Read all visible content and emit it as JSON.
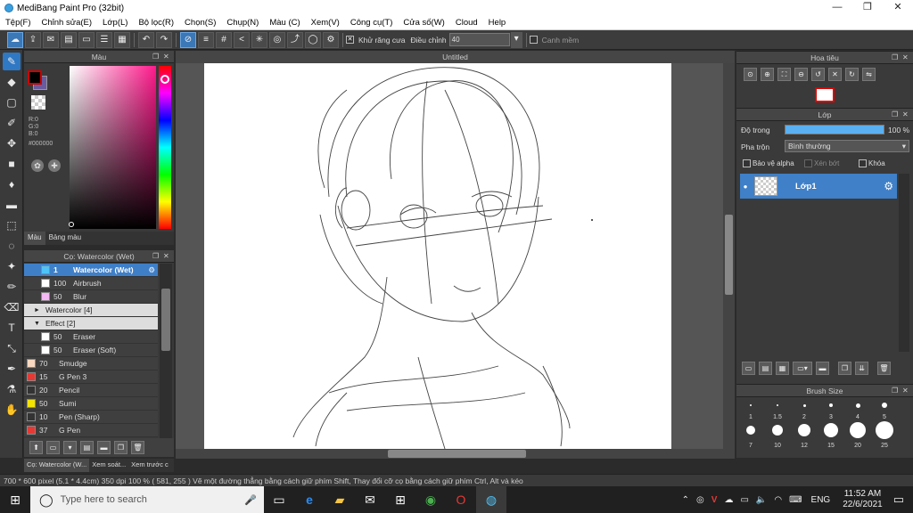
{
  "app": {
    "title": "MediBang Paint Pro (32bit)"
  },
  "menu": [
    "Tệp(F)",
    "Chỉnh sửa(E)",
    "Lớp(L)",
    "Bộ lọc(R)",
    "Chọn(S)",
    "Chụp(N)",
    "Màu (C)",
    "Xem(V)",
    "Công cụ(T)",
    "Cửa số(W)",
    "Cloud",
    "Help"
  ],
  "toolbar": {
    "antialias_label": "Khử răng cưa",
    "adjust_label": "Điều chỉnh",
    "adjust_value": "40",
    "edge_label": "Canh mềm"
  },
  "color_panel": {
    "title": "Màu",
    "rgb": [
      "R:0",
      "G:0",
      "B:0"
    ],
    "hex": "#000000",
    "tabs": [
      "Màu",
      "Bảng màu"
    ],
    "primary_color": "#000000",
    "secondary_color": "#6a5aa0",
    "hue_color": "#ff1a8c"
  },
  "brush_panel": {
    "title": "Cọ: Watercolor (Wet)",
    "rows": [
      {
        "size": "1",
        "name": "Watercolor (Wet)",
        "color": "#4fc3f7",
        "indent": 2,
        "selected": true
      },
      {
        "size": "100",
        "name": "Airbrush",
        "color": "#ffffff",
        "indent": 2
      },
      {
        "size": "50",
        "name": "Blur",
        "color": "#f4b8f4",
        "indent": 2
      },
      {
        "name": "Watercolor [4]",
        "group": true,
        "arrow": "►",
        "indent": 1
      },
      {
        "name": "Effect [2]",
        "group": true,
        "arrow": "▼",
        "indent": 1
      },
      {
        "size": "50",
        "name": "Eraser",
        "color": "#ffffff",
        "indent": 2
      },
      {
        "size": "50",
        "name": "Eraser (Soft)",
        "color": "#ffffff",
        "indent": 2
      },
      {
        "size": "70",
        "name": "Smudge",
        "color": "#f8d8c0",
        "indent": 0
      },
      {
        "size": "15",
        "name": "G Pen 3",
        "color": "#e53935",
        "indent": 0
      },
      {
        "size": "20",
        "name": "Pencil",
        "color": "#333333",
        "indent": 0
      },
      {
        "size": "50",
        "name": "Sumi",
        "color": "#f4e400",
        "indent": 0
      },
      {
        "size": "10",
        "name": "Pen (Sharp)",
        "color": "#333333",
        "indent": 0
      },
      {
        "size": "37",
        "name": "G Pen",
        "color": "#e53935",
        "indent": 0
      }
    ],
    "bottom_tabs": [
      "Cọ: Watercolor (W...",
      "Xem soát...",
      "Xem trước c"
    ]
  },
  "canvas": {
    "tab": "Untitled"
  },
  "navigator": {
    "title": "Hoa tiêu"
  },
  "layer_panel": {
    "title": "Lớp",
    "opacity_label": "Độ trong",
    "opacity_value": "100 %",
    "opacity": 1.0,
    "blend_label": "Pha trộn",
    "blend_value": "Bình thường",
    "protect_alpha": "Bảo vệ alpha",
    "clip": "Xén bớt",
    "lock": "Khóa",
    "layer_name": "Lớp1"
  },
  "brush_size": {
    "title": "Brush Size",
    "row1": [
      "1",
      "1.5",
      "2",
      "3",
      "4",
      "5"
    ],
    "row2": [
      "7",
      "10",
      "12",
      "15",
      "20",
      "25"
    ]
  },
  "status": {
    "text": "700 * 600 pixel  (5.1 * 4.4cm)  350 dpi  100 %  ( 581, 255 )  Vẽ một đường thẳng bằng cách giữ phím Shift, Thay đổi cỡ cọ bằng cách giữ phím Ctrl, Alt và kéo"
  },
  "taskbar": {
    "search_placeholder": "Type here to search",
    "lang": "ENG",
    "time": "11:52 AM",
    "date": "22/6/2021"
  }
}
